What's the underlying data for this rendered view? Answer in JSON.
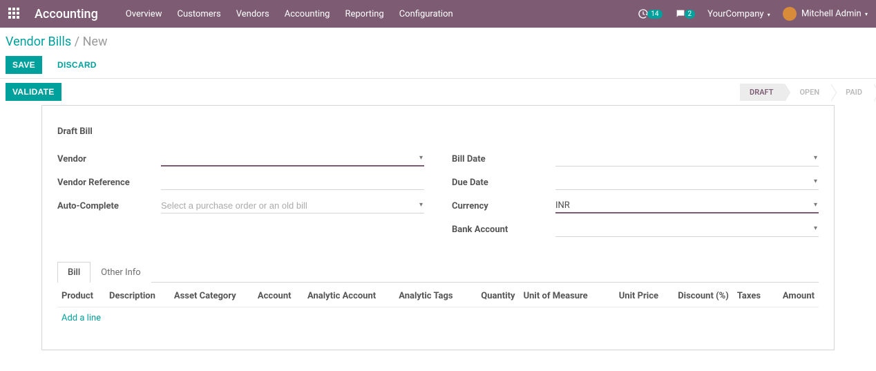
{
  "navbar": {
    "brand": "Accounting",
    "links": [
      "Overview",
      "Customers",
      "Vendors",
      "Accounting",
      "Reporting",
      "Configuration"
    ],
    "activity_count": "14",
    "message_count": "2",
    "company": "YourCompany",
    "user": "Mitchell Admin"
  },
  "breadcrumb": {
    "back": "Vendor Bills",
    "sep": "/",
    "current": "New"
  },
  "buttons": {
    "save": "SAVE",
    "discard": "DISCARD",
    "validate": "VALIDATE"
  },
  "status": {
    "draft": "DRAFT",
    "open": "OPEN",
    "paid": "PAID"
  },
  "sheet": {
    "title": "Draft Bill",
    "left": {
      "vendor_label": "Vendor",
      "vendor_value": "",
      "vendor_ref_label": "Vendor Reference",
      "vendor_ref_value": "",
      "autocomplete_label": "Auto-Complete",
      "autocomplete_placeholder": "Select a purchase order or an old bill"
    },
    "right": {
      "bill_date_label": "Bill Date",
      "bill_date_value": "",
      "due_date_label": "Due Date",
      "due_date_value": "",
      "currency_label": "Currency",
      "currency_value": "INR",
      "bank_label": "Bank Account",
      "bank_value": ""
    }
  },
  "tabs": {
    "bill": "Bill",
    "other": "Other Info"
  },
  "table": {
    "headers": {
      "product": "Product",
      "description": "Description",
      "asset_cat": "Asset Category",
      "account": "Account",
      "analytic_account": "Analytic Account",
      "analytic_tags": "Analytic Tags",
      "quantity": "Quantity",
      "uom": "Unit of Measure",
      "unit_price": "Unit Price",
      "discount": "Discount (%)",
      "taxes": "Taxes",
      "amount": "Amount"
    },
    "add_line": "Add a line"
  }
}
